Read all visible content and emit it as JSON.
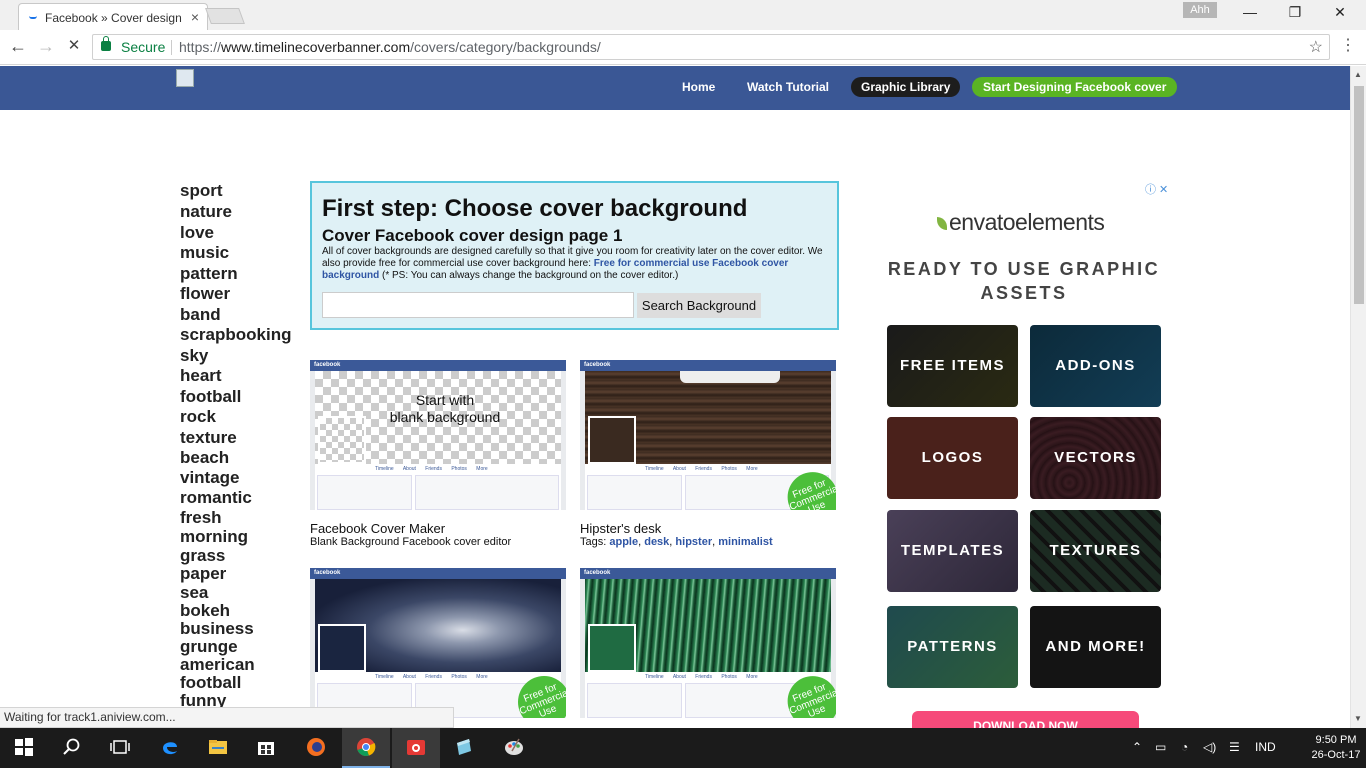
{
  "browser": {
    "tab_title": "Facebook » Cover design",
    "tab_close": "×",
    "profile_label": "Ahh",
    "window_controls": {
      "minimize": "—",
      "restore": "❐",
      "close": "✕"
    },
    "nav": {
      "back": "←",
      "forward": "→",
      "stop": "✕"
    },
    "secure_label": "Secure",
    "url_scheme": "https://",
    "url_host": "www.timelinecoverbanner.com",
    "url_path": "/covers/category/backgrounds/",
    "star": "☆",
    "menu": "⋮"
  },
  "site_nav": {
    "home": "Home",
    "tutorial": "Watch Tutorial",
    "library": "Graphic Library",
    "start": "Start Designing Facebook cover"
  },
  "categories": [
    "sport",
    "nature",
    "love",
    "music",
    "pattern",
    "flower",
    "band",
    "scrapbooking",
    "sky",
    "heart",
    "football",
    "rock",
    "texture",
    "beach",
    "vintage",
    "romantic",
    "fresh",
    "morning",
    "grass",
    "paper",
    "sea",
    "bokeh",
    "business",
    "grunge",
    "american",
    "football",
    "funny"
  ],
  "step_box": {
    "title": "First step: Choose cover background",
    "subtitle": "Cover Facebook cover design page 1",
    "desc_1": "All of cover backgrounds are designed carefully so that it give you room for creativity later on the cover editor. We also provide free for commercial use cover background here: ",
    "desc_link": "Free for commercial use Facebook cover background",
    "desc_2": " (* PS: You can always change the background on the cover editor.)",
    "search_value": "",
    "search_button": "Search Background"
  },
  "covers": {
    "fb_label": "facebook",
    "timeline_tabs": "Timeline About Friends Photos More",
    "free_badge": "Free for Commercial Use",
    "items": [
      {
        "name": "Facebook Cover Maker",
        "sub": "Blank Background Facebook cover editor",
        "overlay_1": "Start with",
        "overlay_2": "blank background"
      },
      {
        "name": "Hipster's desk",
        "tags_label": "Tags: ",
        "tags": [
          "apple",
          "desk",
          "hipster",
          "minimalist"
        ]
      },
      {
        "name": "",
        "sub": ""
      },
      {
        "name": "",
        "sub": ""
      }
    ]
  },
  "ad": {
    "info": "ⓘ ✕",
    "brand": "envatoelements",
    "headline": "READY TO USE GRAPHIC ASSETS",
    "tiles": [
      "FREE ITEMS",
      "ADD-ONS",
      "LOGOS",
      "VECTORS",
      "TEMPLATES",
      "TEXTURES",
      "PATTERNS",
      "AND MORE!"
    ],
    "cta": "DOWNLOAD NOW"
  },
  "status_text": "Waiting for track1.aniview.com...",
  "taskbar": {
    "tray_lang": "IND",
    "time": "9:50 PM",
    "date": "26-Oct-17"
  },
  "colors": {
    "site_header": "#3a5795",
    "start_button": "#5ab423",
    "free_badge": "#4cbf3a",
    "link": "#2f55a4",
    "cta": "#f64a7a"
  }
}
